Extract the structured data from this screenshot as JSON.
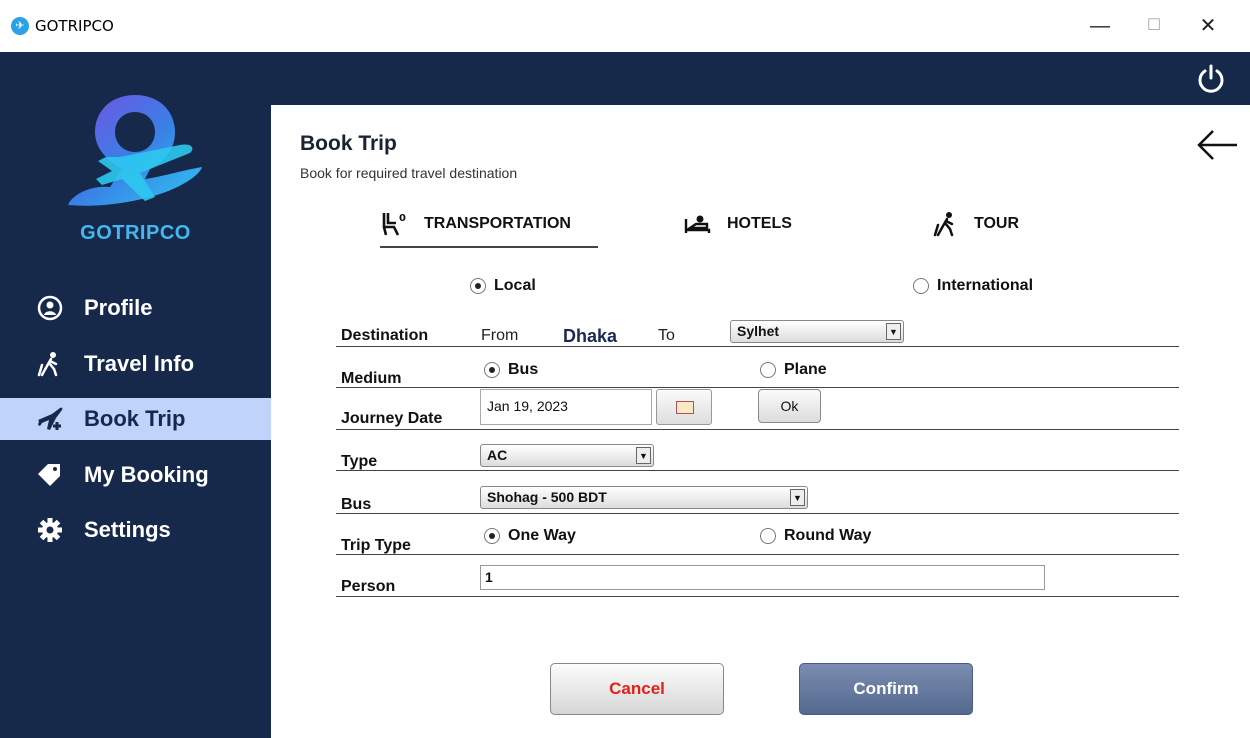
{
  "window": {
    "title": "GOTRIPCO",
    "minimize_glyph": "—",
    "maximize_glyph": "☐",
    "close_glyph": "✕"
  },
  "sidebar": {
    "brand": "GOTRIPCO",
    "items": [
      {
        "label": "Profile",
        "icon": "user-circle-icon"
      },
      {
        "label": "Travel Info",
        "icon": "walking-person-icon"
      },
      {
        "label": "Book Trip",
        "icon": "plane-plus-icon"
      },
      {
        "label": "My Booking",
        "icon": "tags-icon"
      },
      {
        "label": "Settings",
        "icon": "gear-icon"
      }
    ],
    "active": "Book Trip"
  },
  "header": {
    "title": "Book Trip",
    "subtitle": "Book for required travel destination"
  },
  "tabs": [
    {
      "label": "TRANSPORTATION",
      "icon": "seat-icon",
      "selected": true
    },
    {
      "label": "HOTELS",
      "icon": "bed-icon",
      "selected": false
    },
    {
      "label": "TOUR",
      "icon": "hiker-icon",
      "selected": false
    }
  ],
  "scope": {
    "local_label": "Local",
    "international_label": "International",
    "selected": "Local"
  },
  "form": {
    "destination": {
      "label": "Destination",
      "from_label": "From",
      "from_value": "Dhaka",
      "to_label": "To",
      "to_value": "Sylhet"
    },
    "medium": {
      "label": "Medium",
      "option_bus": "Bus",
      "option_plane": "Plane",
      "selected": "Bus"
    },
    "journey_date": {
      "label": "Journey Date",
      "value": "Jan 19, 2023",
      "ok_label": "Ok"
    },
    "type": {
      "label": "Type",
      "value": "AC"
    },
    "bus": {
      "label": "Bus",
      "value": "Shohag - 500 BDT"
    },
    "trip_type": {
      "label": "Trip Type",
      "option_one_way": "One Way",
      "option_round_way": "Round Way",
      "selected": "One Way"
    },
    "person": {
      "label": "Person",
      "value": "1"
    }
  },
  "actions": {
    "cancel_label": "Cancel",
    "confirm_label": "Confirm"
  },
  "colors": {
    "sidebar_bg": "#17294a",
    "active_item_bg": "#bfd3fb",
    "brand_text": "#45b6ee",
    "cancel_text": "#e0211b",
    "confirm_bg": "#62769b"
  }
}
